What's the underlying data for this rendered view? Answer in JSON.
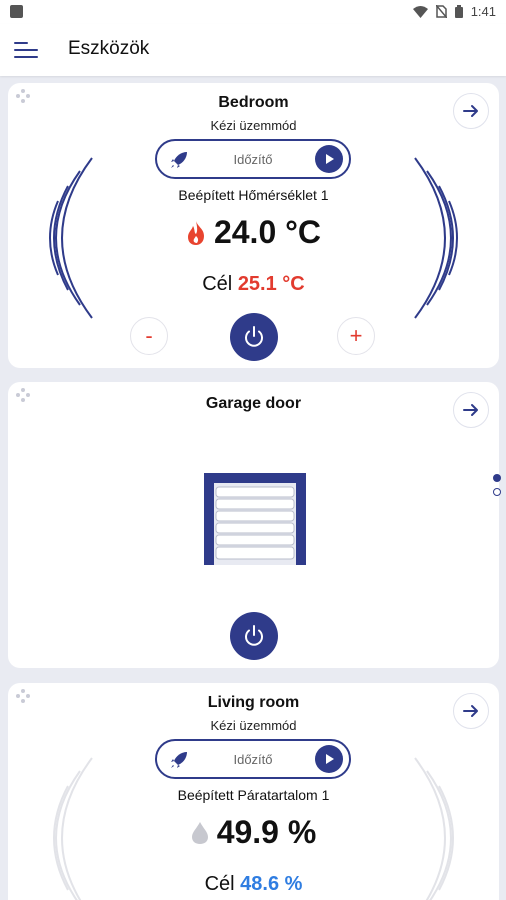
{
  "status_bar": {
    "time": "1:41"
  },
  "app_bar": {
    "title": "Eszközök"
  },
  "cards": [
    {
      "title": "Bedroom",
      "mode": "Kézi üzemmód",
      "timer_label": "Időzítő",
      "sensor": "Beépített Hőmérséklet 1",
      "reading": "24.0 °C",
      "target_prefix": "Cél",
      "target_value": "25.1 °C",
      "minus_label": "-",
      "plus_label": "+"
    },
    {
      "title": "Garage door"
    },
    {
      "title": "Living room",
      "mode": "Kézi üzemmód",
      "timer_label": "Időzítő",
      "sensor": "Beépített Páratartalom 1",
      "reading": "49.9 %",
      "target_prefix": "Cél",
      "target_value": "48.6 %"
    }
  ],
  "icons": {
    "menu": "hamburger-icon",
    "drag": "drag-handle-icon",
    "nav": "arrow-right-icon",
    "timer": "rocket-icon",
    "play": "play-icon",
    "heat": "flame-icon",
    "humidity": "drop-icon",
    "power": "power-icon",
    "garage": "garage-door-icon"
  },
  "colors": {
    "accent": "#2f3b8a",
    "heat": "#e23b2f",
    "humidity_target": "#2f7de1",
    "background": "#e9ebf2"
  },
  "pager": {
    "pages": 2,
    "current": 1
  }
}
